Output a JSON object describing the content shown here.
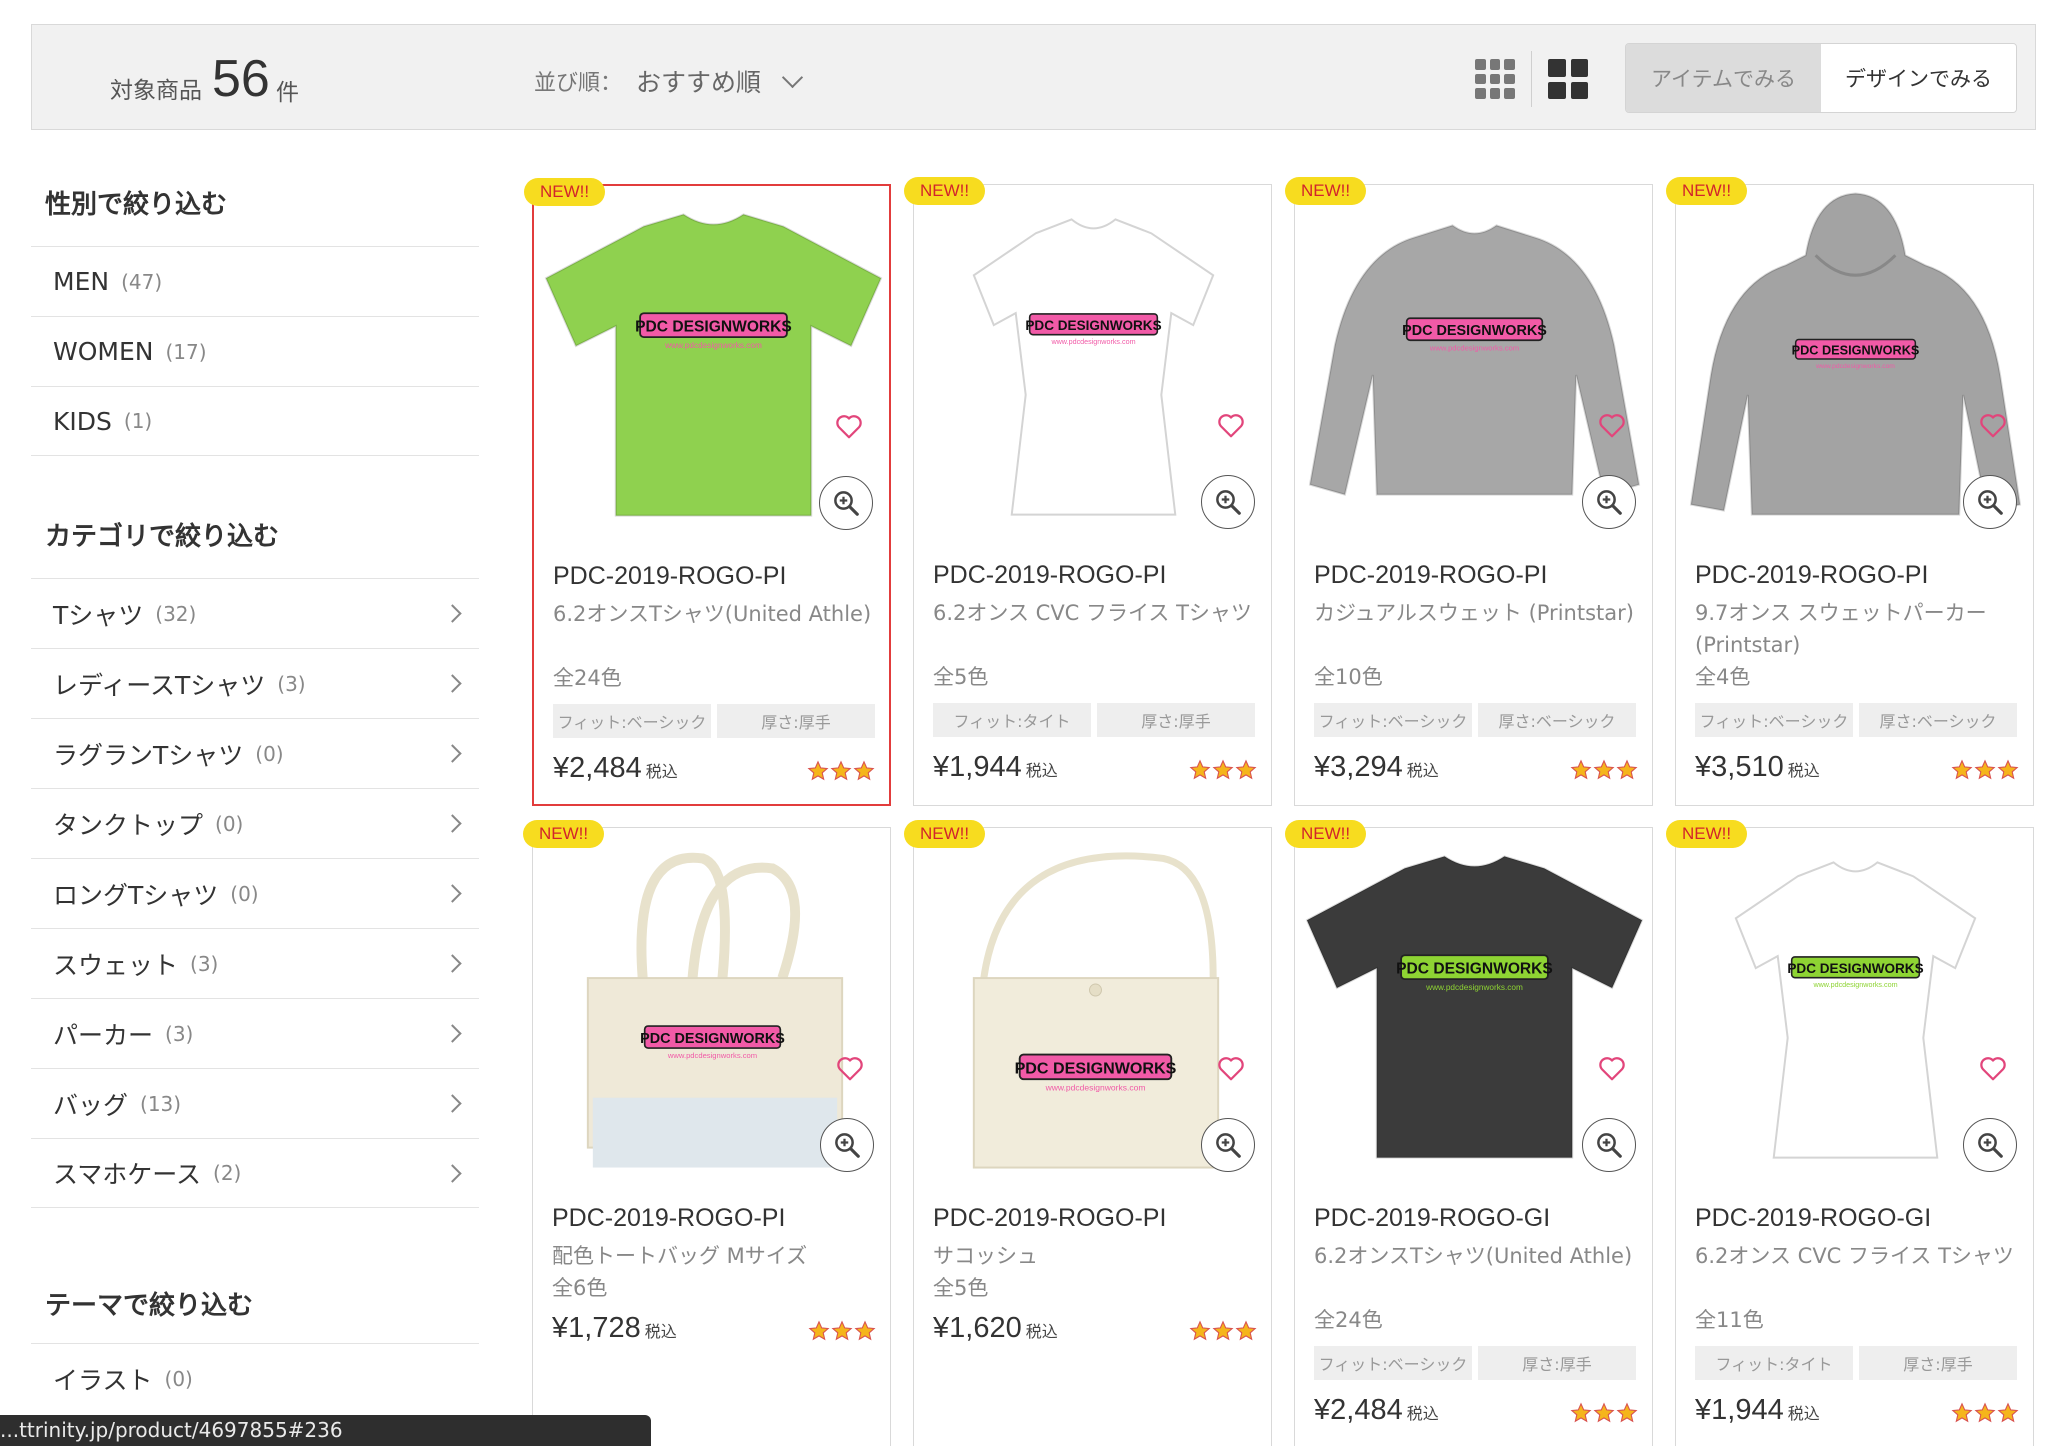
{
  "header": {
    "count_label": "対象商品",
    "count": "56",
    "count_unit": "件",
    "sort_label": "並び順：",
    "sort_value": "おすすめ順",
    "toggle_item": "アイテムでみる",
    "toggle_design": "デザインでみる"
  },
  "sidebar": {
    "gender_heading": "性別で絞り込む",
    "gender": [
      {
        "label": "MEN",
        "count": "(47)"
      },
      {
        "label": "WOMEN",
        "count": "(17)"
      },
      {
        "label": "KIDS",
        "count": "(1)"
      }
    ],
    "category_heading": "カテゴリで絞り込む",
    "categories": [
      {
        "label": "Tシャツ",
        "count": "(32)"
      },
      {
        "label": "レディースTシャツ",
        "count": "(3)"
      },
      {
        "label": "ラグランTシャツ",
        "count": "(0)"
      },
      {
        "label": "タンクトップ",
        "count": "(0)"
      },
      {
        "label": "ロングTシャツ",
        "count": "(0)"
      },
      {
        "label": "スウェット",
        "count": "(3)"
      },
      {
        "label": "パーカー",
        "count": "(3)"
      },
      {
        "label": "バッグ",
        "count": "(13)"
      },
      {
        "label": "スマホケース",
        "count": "(2)"
      }
    ],
    "theme_heading": "テーマで絞り込む",
    "themes": [
      {
        "label": "イラスト",
        "count": "(0)"
      }
    ]
  },
  "badge_new": "NEW!!",
  "tax_label": "税込",
  "logo_text": "PDC DESIGNWORKS",
  "logo_url": "www.pdcdesignworks.com",
  "colors": {
    "accent_red": "#e23c3c",
    "badge_yellow": "#f7dc1f",
    "logo_pink": "#f15aa7",
    "logo_green": "#8ed433"
  },
  "products": [
    {
      "code": "PDC-2019-ROGO-PI",
      "name": "6.2オンスTシャツ(United Athle)",
      "colors": "全24色",
      "tags": [
        "フィット:ベーシック",
        "厚さ:厚手"
      ],
      "price": "¥2,484",
      "garment": "tshirt",
      "garment_color": "#8fd14f",
      "rating": 3
    },
    {
      "code": "PDC-2019-ROGO-PI",
      "name": "6.2オンス CVC フライス Tシャツ",
      "colors": "全5色",
      "tags": [
        "フィット:タイト",
        "厚さ:厚手"
      ],
      "price": "¥1,944",
      "garment": "ladies-tshirt",
      "garment_color": "#ffffff",
      "rating": 3
    },
    {
      "code": "PDC-2019-ROGO-PI",
      "name": "カジュアルスウェット (Printstar)",
      "colors": "全10色",
      "tags": [
        "フィット:ベーシック",
        "厚さ:ベーシック"
      ],
      "price": "¥3,294",
      "garment": "sweat",
      "garment_color": "#a7a7a7",
      "rating": 3
    },
    {
      "code": "PDC-2019-ROGO-PI",
      "name": "9.7オンス スウェットパーカー (Printstar)",
      "colors": "全4色",
      "tags": [
        "フィット:ベーシック",
        "厚さ:ベーシック"
      ],
      "price": "¥3,510",
      "garment": "hoodie",
      "garment_color": "#a3a3a3",
      "rating": 3
    },
    {
      "code": "PDC-2019-ROGO-PI",
      "name": "配色トートバッグ Mサイズ",
      "colors": "全6色",
      "tags": [],
      "price": "¥1,728",
      "garment": "tote",
      "garment_color": "#efe9d8",
      "rating": 3
    },
    {
      "code": "PDC-2019-ROGO-PI",
      "name": "サコッシュ",
      "colors": "全5色",
      "tags": [],
      "price": "¥1,620",
      "garment": "sacoche",
      "garment_color": "#f1ecdb",
      "rating": 3
    },
    {
      "code": "PDC-2019-ROGO-GI",
      "name": "6.2オンスTシャツ(United Athle)",
      "colors": "全24色",
      "tags": [
        "フィット:ベーシック",
        "厚さ:厚手"
      ],
      "price": "¥2,484",
      "garment": "tshirt",
      "garment_color": "#3b3b3b",
      "rating": 3
    },
    {
      "code": "PDC-2019-ROGO-GI",
      "name": "6.2オンス CVC フライス Tシャツ",
      "colors": "全11色",
      "tags": [
        "フィット:タイト",
        "厚さ:厚手"
      ],
      "price": "¥1,944",
      "garment": "ladies-tshirt",
      "garment_color": "#ffffff",
      "rating": 3
    }
  ],
  "status_url": "...ttrinity.jp/product/4697855#236"
}
